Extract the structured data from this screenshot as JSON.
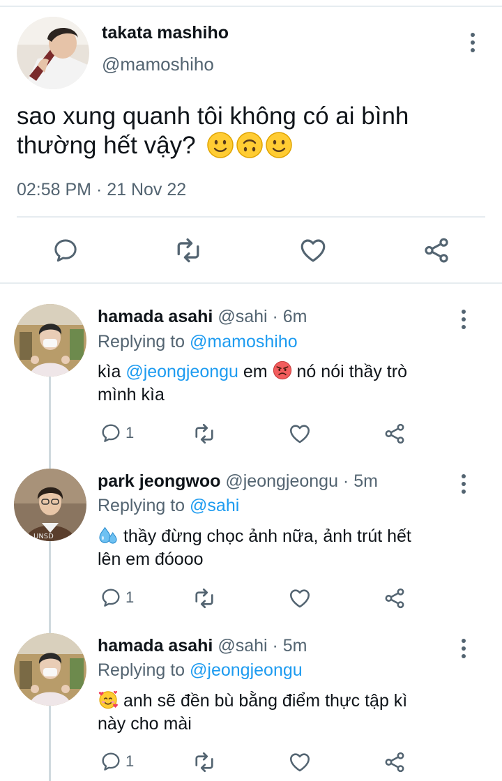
{
  "main_tweet": {
    "display_name": "takata mashiho",
    "handle": "@mamoshiho",
    "text": "sao xung quanh tôi không có ai bình thường hết vậy?",
    "text_line1": "sao xung quanh tôi không có ai bình",
    "text_line2": "thường hết vậy?",
    "emojis": [
      "slightly-smiling-face",
      "upside-down-face",
      "slightly-smiling-face"
    ],
    "timestamp": "02:58 PM · 21 Nov 22",
    "actions": [
      "reply-icon",
      "retweet-icon",
      "like-icon",
      "share-icon"
    ]
  },
  "replies": [
    {
      "display_name": "hamada asahi",
      "handle_time": "@sahi · 6m",
      "replying_label": "Replying to",
      "replying_to": "@mamoshiho",
      "line1_prefix": "kìa",
      "mention": "@jeongjeongu",
      "line1_middle": "em",
      "emoji": "pouting-face",
      "line1_suffix": "nó nói thầy trò",
      "line2": "mình kìa",
      "reply_count": "1"
    },
    {
      "display_name": "park jeongwoo",
      "handle_time": "@jeongjeongu · 5m",
      "replying_label": "Replying to",
      "replying_to": "@sahi",
      "emoji": "sweat-droplets",
      "line1": "thầy đừng chọc ảnh nữa, ảnh trút hết",
      "line2": "lên em đóooo",
      "reply_count": "1"
    },
    {
      "display_name": "hamada asahi",
      "handle_time": "@sahi · 5m",
      "replying_label": "Replying to",
      "replying_to": "@jeongjeongu",
      "emoji": "smiling-face-with-hearts",
      "line1": "anh sẽ đền bù bằng điểm thực tập kì",
      "line2": "này cho mài",
      "reply_count": "1"
    }
  ],
  "colors": {
    "accent": "#1d9bf0",
    "secondary_text": "#536471",
    "icon": "#536471",
    "divider": "#e6ecf0"
  }
}
